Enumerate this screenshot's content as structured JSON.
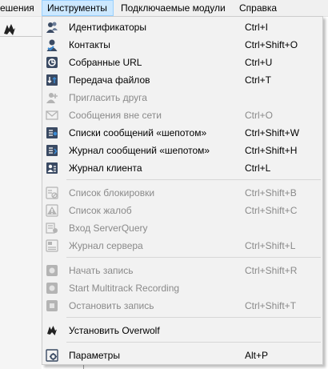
{
  "menubar": {
    "items": [
      {
        "label": "ешения"
      },
      {
        "label": "Инструменты"
      },
      {
        "label": "Подключаемые модули"
      },
      {
        "label": "Справка"
      }
    ]
  },
  "toolbar": {
    "icon": "overwolf-icon"
  },
  "menu": {
    "items": [
      {
        "label": "Идентификаторы",
        "shortcut": "Ctrl+I",
        "icon": "identities-icon",
        "enabled": true
      },
      {
        "label": "Контакты",
        "shortcut": "Ctrl+Shift+O",
        "icon": "contacts-icon",
        "enabled": true
      },
      {
        "label": "Собранные URL",
        "shortcut": "Ctrl+U",
        "icon": "url-catcher-icon",
        "enabled": true
      },
      {
        "label": "Передача файлов",
        "shortcut": "Ctrl+T",
        "icon": "file-transfer-icon",
        "enabled": true
      },
      {
        "label": "Пригласить друга",
        "shortcut": "",
        "icon": "invite-buddy-icon",
        "enabled": false
      },
      {
        "label": "Сообщения вне сети",
        "shortcut": "Ctrl+O",
        "icon": "offline-messages-icon",
        "enabled": false
      },
      {
        "label": "Списки сообщений «шепотом»",
        "shortcut": "Ctrl+Shift+W",
        "icon": "whisper-lists-icon",
        "enabled": true
      },
      {
        "label": "Журнал сообщений «шепотом»",
        "shortcut": "Ctrl+Shift+H",
        "icon": "whisper-history-icon",
        "enabled": true
      },
      {
        "label": "Журнал клиента",
        "shortcut": "Ctrl+L",
        "icon": "client-log-icon",
        "enabled": true
      },
      {
        "label": "Список блокировки",
        "shortcut": "Ctrl+Shift+B",
        "icon": "ban-list-icon",
        "enabled": false
      },
      {
        "label": "Список жалоб",
        "shortcut": "Ctrl+Shift+C",
        "icon": "complaints-icon",
        "enabled": false
      },
      {
        "label": "Вход ServerQuery",
        "shortcut": "",
        "icon": "serverquery-login-icon",
        "enabled": false
      },
      {
        "label": "Журнал сервера",
        "shortcut": "Ctrl+Shift+L",
        "icon": "server-log-icon",
        "enabled": false
      },
      {
        "label": "Начать запись",
        "shortcut": "Ctrl+Shift+R",
        "icon": "record-start-icon",
        "enabled": false
      },
      {
        "label": "Start Multitrack Recording",
        "shortcut": "",
        "icon": "multitrack-record-icon",
        "enabled": false
      },
      {
        "label": "Остановить запись",
        "shortcut": "Ctrl+Shift+T",
        "icon": "record-stop-icon",
        "enabled": false
      },
      {
        "label": "Установить Overwolf",
        "shortcut": "",
        "icon": "overwolf-icon",
        "enabled": true
      },
      {
        "label": "Параметры",
        "shortcut": "Alt+P",
        "icon": "options-icon",
        "enabled": true
      }
    ]
  }
}
